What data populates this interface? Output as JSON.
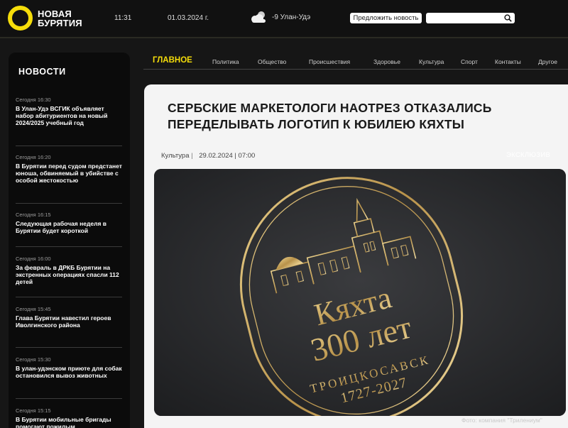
{
  "header": {
    "logo_line1": "НОВАЯ",
    "logo_line2": "БУРЯТИЯ",
    "time": "11:31",
    "date": "01.03.2024 г.",
    "weather_text": "-9 Улан-Удэ",
    "weather_icon": "cloud-sun-icon",
    "suggest_label": "Предложить новость",
    "search_placeholder": "",
    "accent_color": "#f5dd0a"
  },
  "sidebar": {
    "title": "НОВОСТИ",
    "items": [
      {
        "time": "Сегодня 16:30",
        "text": "В Улан-Удэ ВСГИК объявляет набор абитуриентов на новый 2024/2025 учебный год"
      },
      {
        "time": "Сегодня 16:20",
        "text": "В Бурятии перед судом предстанет юноша, обвиняемый в убийстве с особой жестокостью"
      },
      {
        "time": "Сегодня 16:15",
        "text": "Следующая рабочая неделя в Бурятии будет короткой"
      },
      {
        "time": "Сегодня 16:00",
        "text": "За февраль в ДРКБ Бурятии на экстренных операциях спасли 112 детей"
      },
      {
        "time": "Сегодня 15:45",
        "text": "Глава Бурятии навестил героев Иволгинского района"
      },
      {
        "time": "Сегодня 15:30",
        "text": "В улан-удэнском приюте для собак остановился вывоз животных"
      },
      {
        "time": "Сегодня 15:15",
        "text": "В Бурятии мобильные бригады помогают пожилым"
      }
    ]
  },
  "nav": {
    "items": [
      "ГЛАВНОЕ",
      "Политика",
      "Общество",
      "Происшествия",
      "Здоровье",
      "Культура",
      "Спорт",
      "Контакты",
      "Другое"
    ]
  },
  "article": {
    "title": "СЕРБСКИЕ МАРКЕТОЛОГИ НАОТРЕЗ ОТКАЗАЛИСЬ ПЕРЕДЕЛЫВАТЬ ЛОГОТИП К ЮБИЛЕЮ КЯХТЫ",
    "category": "Культура",
    "datetime": "29.02.2024 | 07:00",
    "exclusive": "ЭКСКЛЮЗИВ",
    "photo": {
      "line1": "Кяхта",
      "line2": "300 лет",
      "arc_text": "ТРОИЦКОСАВСК",
      "years": "1727-2027"
    },
    "caption": "Фото: компания \"Трилениум\""
  }
}
